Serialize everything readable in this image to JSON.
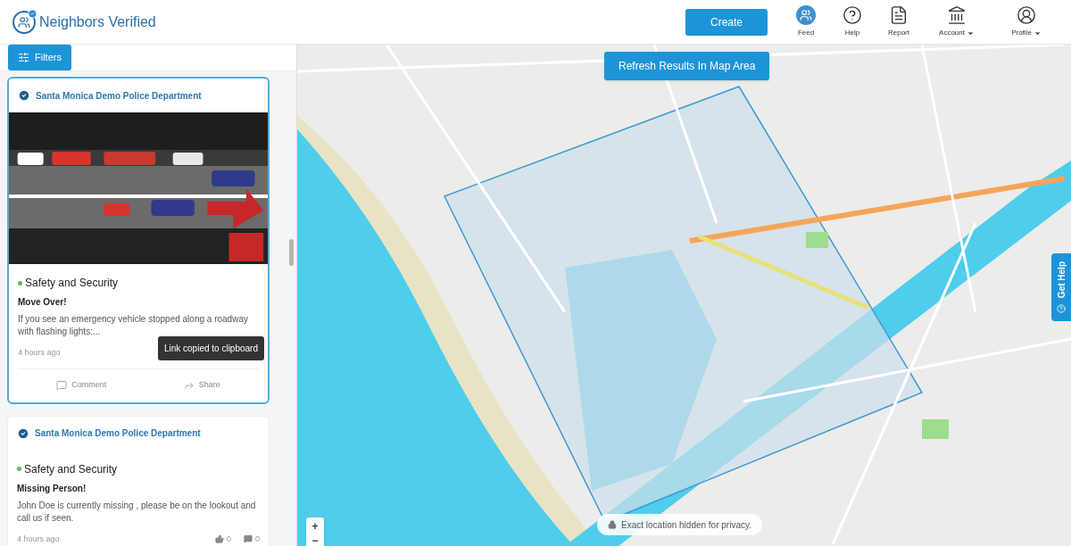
{
  "header": {
    "brand": "Neighbors Verified",
    "create_button": "Create",
    "nav": [
      {
        "kind": "feed",
        "label": "Feed",
        "dropdown": false
      },
      {
        "kind": "help",
        "label": "Help",
        "dropdown": false
      },
      {
        "kind": "report",
        "label": "Report",
        "dropdown": false
      },
      {
        "kind": "account",
        "label": "Account",
        "dropdown": true
      },
      {
        "kind": "profile",
        "label": "Profile",
        "dropdown": true
      }
    ]
  },
  "sidebar": {
    "filters_button": "Filters",
    "posts": [
      {
        "author": "Santa Monica Demo Police Department",
        "selected": true,
        "category": "Safety and Security",
        "color": "#5cb85c",
        "title": "Move Over!",
        "body": "If you see an emergency vehicle stopped along a roadway with flashing lights:...",
        "time": "4 hours ago",
        "footer": {
          "kind": "actions",
          "comment": "Comment",
          "share": "Share",
          "tooltip": "Link copied to clipboard"
        }
      },
      {
        "author": "Santa Monica Demo Police Department",
        "selected": false,
        "category": "Safety and Security",
        "color": "#5cb85c",
        "title": "Missing Person!",
        "body": "John Doe is currently missing , please be on the lookout and call us if seen.",
        "time": "4 hours ago",
        "footer": {
          "kind": "counts",
          "likes": "0",
          "comments": "0"
        }
      }
    ]
  },
  "map": {
    "kind": "picture",
    "refresh_button": "Refresh Results In Map Area",
    "zoom_in": "+",
    "zoom_out": "−",
    "privacy_note": "Exact location hidden for privacy.",
    "get_help": "Get Help"
  }
}
